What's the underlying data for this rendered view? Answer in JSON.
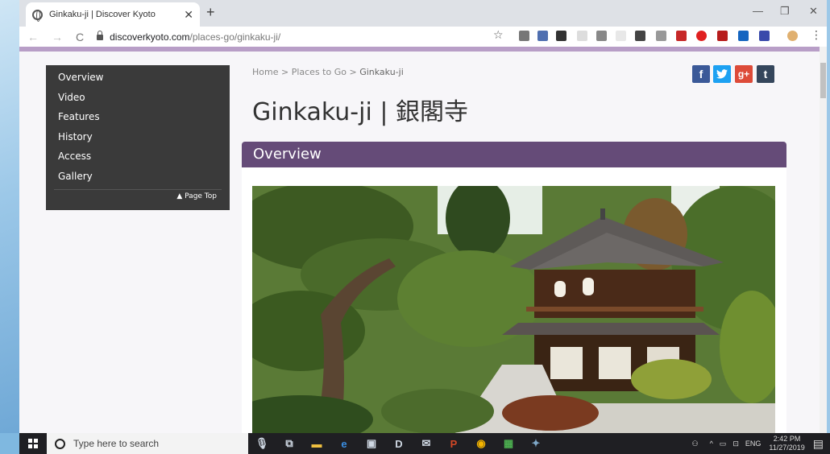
{
  "browser": {
    "tab_title": "Ginkaku-ji | Discover Kyoto",
    "url_host": "discoverkyoto.com",
    "url_path": "/places-go/ginkaku-ji/"
  },
  "sidebar": {
    "items": [
      {
        "label": "Overview"
      },
      {
        "label": "Video"
      },
      {
        "label": "Features"
      },
      {
        "label": "History"
      },
      {
        "label": "Access"
      },
      {
        "label": "Gallery"
      }
    ],
    "page_top": "▲ Page Top"
  },
  "breadcrumb": {
    "home": "Home",
    "sep1": " > ",
    "places": "Places to Go",
    "sep2": " > ",
    "current": "Ginkaku-ji"
  },
  "page": {
    "title": "Ginkaku-ji | 銀閣寺",
    "section_title": "Overview"
  },
  "social": {
    "facebook": "f",
    "googleplus": "g+",
    "other": "t"
  },
  "colors": {
    "section_header": "#654b78",
    "accent_bar": "#b89ec7",
    "sidebar_bg": "#3a3a3a",
    "facebook": "#3b5998",
    "twitter": "#1da1f2",
    "googleplus": "#dd4b39",
    "other": "#35465c"
  },
  "taskbar": {
    "search_placeholder": "Type here to search",
    "lang": "ENG",
    "time": "2:42 PM",
    "date": "11/27/2019"
  }
}
